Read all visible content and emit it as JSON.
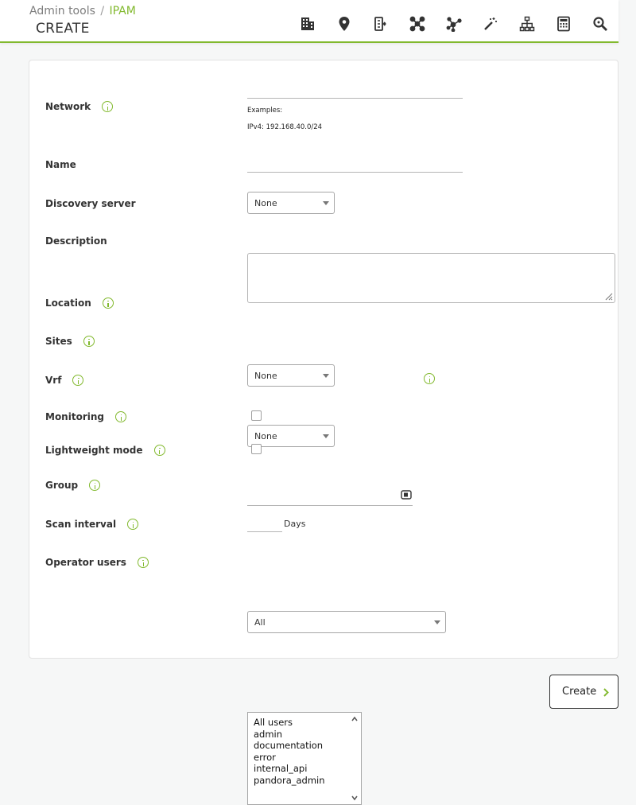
{
  "header": {
    "breadcrumb": {
      "parent": "Admin tools",
      "separator": "/",
      "current": "IPAM"
    },
    "title": "CREATE",
    "toolbar": [
      {
        "name": "building-icon"
      },
      {
        "name": "location-pin-icon"
      },
      {
        "name": "hierarchy-tree-icon"
      },
      {
        "name": "network-nodes-icon"
      },
      {
        "name": "network-graph-icon"
      },
      {
        "name": "magic-wand-icon"
      },
      {
        "name": "sitemap-icon"
      },
      {
        "name": "calculator-icon"
      },
      {
        "name": "search-icon"
      }
    ],
    "accent_color": "#82b92e"
  },
  "form": {
    "network": {
      "label": "Network",
      "value": "",
      "hint_title": "Examples:",
      "hint_example": "IPv4: 192.168.40.0/24"
    },
    "name": {
      "label": "Name",
      "value": ""
    },
    "discovery_server": {
      "label": "Discovery server",
      "selected": "None"
    },
    "description": {
      "label": "Description",
      "value": ""
    },
    "location": {
      "label": "Location",
      "selected": "None"
    },
    "sites": {
      "label": "Sites",
      "selected": "None"
    },
    "vrf": {
      "label": "Vrf",
      "value": ""
    },
    "monitoring": {
      "label": "Monitoring",
      "checked": false
    },
    "lightweight_mode": {
      "label": "Lightweight mode",
      "checked": false
    },
    "group": {
      "label": "Group",
      "selected": "All"
    },
    "scan_interval": {
      "label": "Scan interval",
      "value": "",
      "unit": "Days"
    },
    "operator_users": {
      "label": "Operator users",
      "options": [
        "All users",
        "admin",
        "documentation",
        "error",
        "internal_api",
        "pandora_admin"
      ]
    }
  },
  "actions": {
    "create_label": "Create"
  }
}
